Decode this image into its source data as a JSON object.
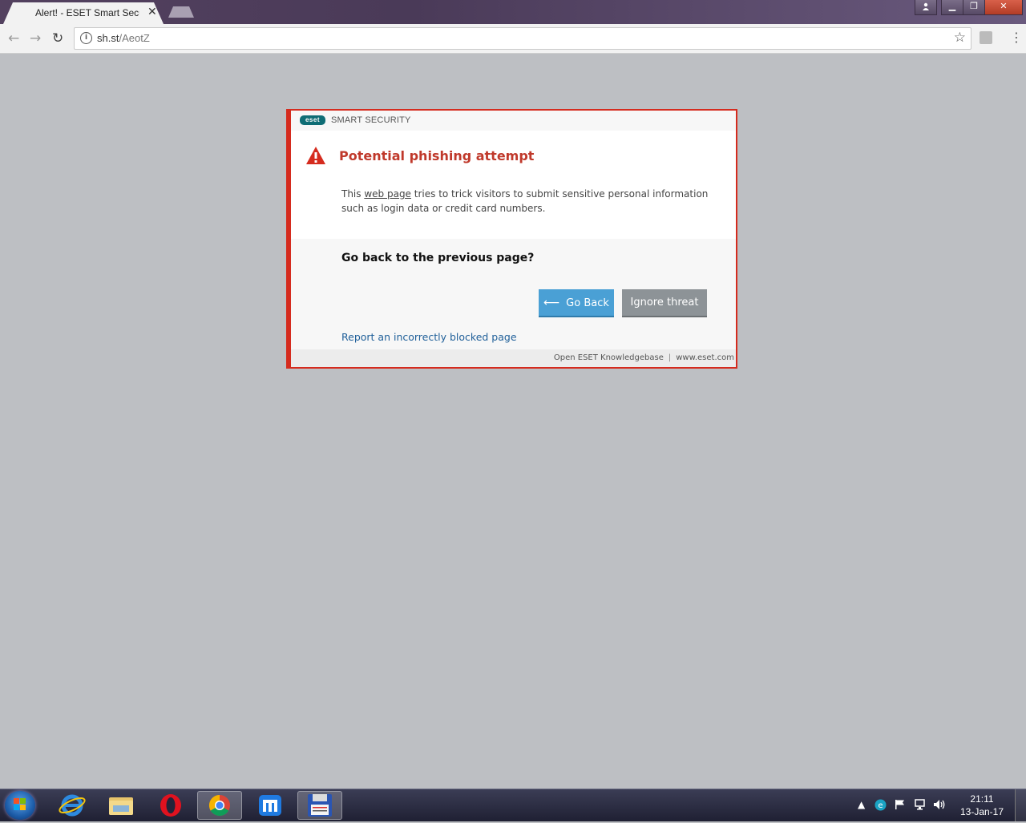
{
  "browser": {
    "tab_title": "Alert! - ESET Smart Secur",
    "url_host": "sh.st",
    "url_path": "/AeotZ"
  },
  "dialog": {
    "brand": "eset",
    "product": "SMART SECURITY",
    "title": "Potential phishing attempt",
    "msg_before": "This ",
    "msg_link": "web page",
    "msg_after": " tries to trick visitors to submit sensitive personal information such as login data or credit card numbers.",
    "question": "Go back to the previous page?",
    "go_back_label": "Go Back",
    "ignore_label": "Ignore threat",
    "report_link": "Report an incorrectly blocked page",
    "footer_knowledgebase": "Open ESET Knowledgebase",
    "footer_separator": "|",
    "footer_site": "www.eset.com"
  },
  "colors": {
    "alert_red": "#d52b1e",
    "button_blue": "#4aa0d5",
    "button_gray": "#8d9397",
    "link_blue": "#1f5f99"
  },
  "taskbar": {
    "clock_time": "21:11",
    "clock_date": "13-Jan-17",
    "icons": [
      "start-orb",
      "internet-explorer-icon",
      "file-explorer-icon",
      "opera-icon",
      "chrome-icon",
      "maxthon-icon",
      "floppy-save-icon"
    ]
  }
}
